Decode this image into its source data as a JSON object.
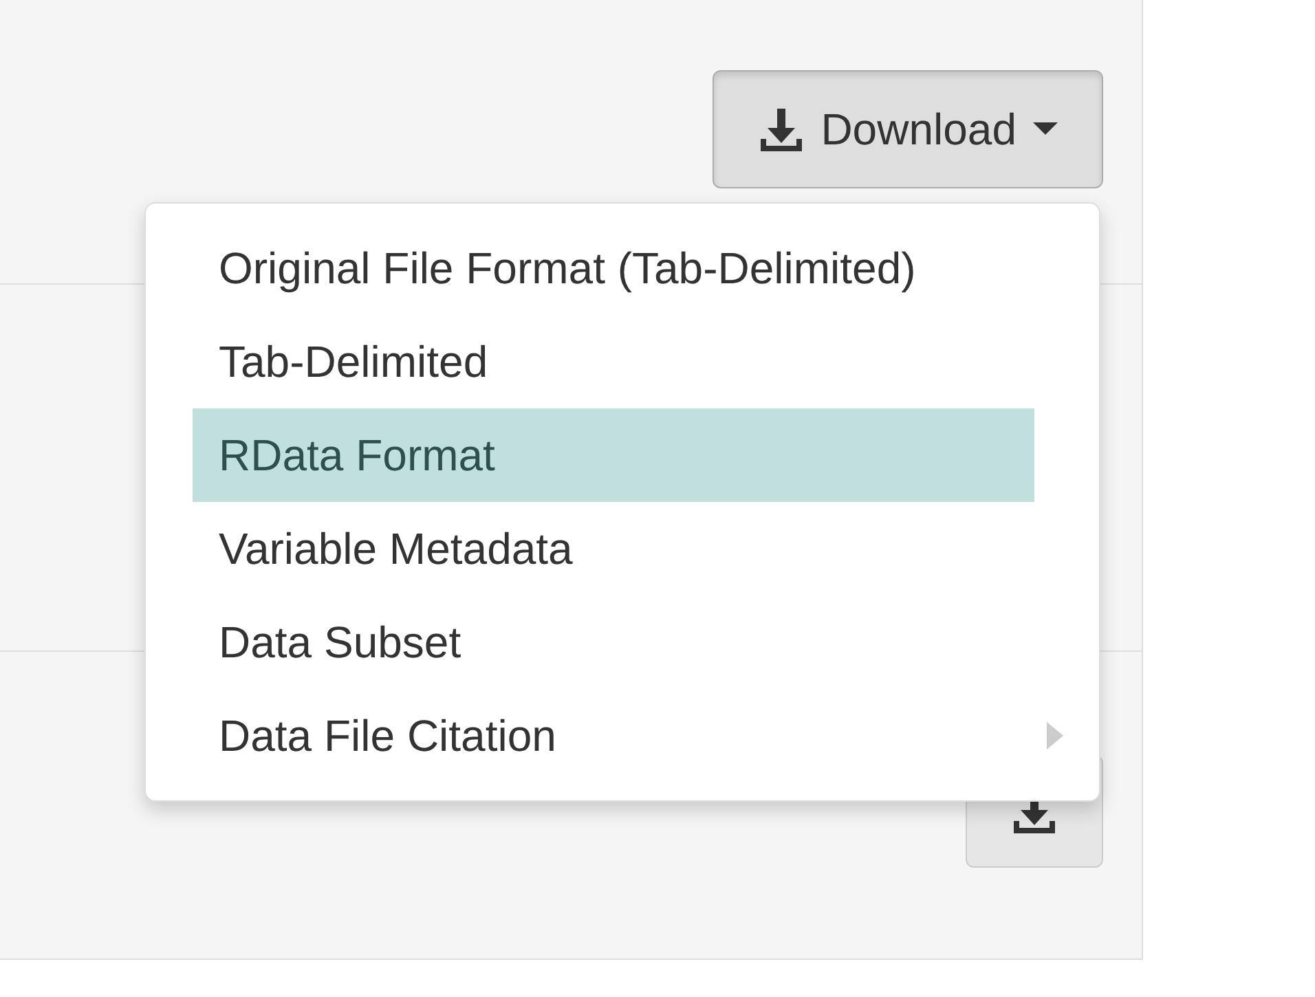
{
  "download_button": {
    "label": "Download",
    "expanded": true
  },
  "menu": [
    {
      "label": "Original File Format (Tab-Delimited)",
      "selected": false,
      "has_submenu": false
    },
    {
      "label": "Tab-Delimited",
      "selected": false,
      "has_submenu": false
    },
    {
      "label": "RData Format",
      "selected": true,
      "has_submenu": false
    },
    {
      "label": "Variable Metadata",
      "selected": false,
      "has_submenu": false
    },
    {
      "label": "Data Subset",
      "selected": false,
      "has_submenu": false
    },
    {
      "label": "Data File Citation",
      "selected": false,
      "has_submenu": true
    }
  ]
}
